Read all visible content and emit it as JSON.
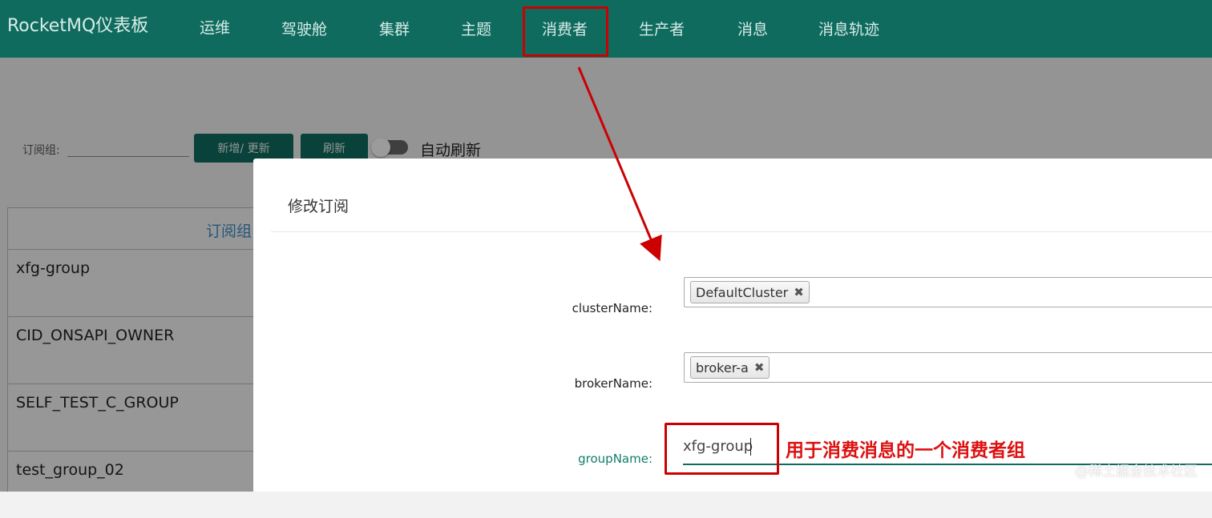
{
  "header": {
    "brand": "RocketMQ仪表板",
    "nav": [
      "运维",
      "驾驶舱",
      "集群",
      "主题",
      "消费者",
      "生产者",
      "消息",
      "消息轨迹"
    ],
    "active_nav": "消费者",
    "color": "#0f6b5e"
  },
  "toolbar": {
    "filter_label": "订阅组:",
    "add_update_label": "新增/ 更新",
    "refresh_label": "刷新",
    "auto_refresh_label": "自动刷新"
  },
  "table": {
    "header": "订阅组",
    "rows": [
      "xfg-group",
      "CID_ONSAPI_OWNER",
      "SELF_TEST_C_GROUP",
      "test_group_02"
    ]
  },
  "modal": {
    "title": "修改订阅",
    "cluster_label": "clusterName:",
    "cluster_tag": "DefaultCluster",
    "broker_label": "brokerName:",
    "broker_tag": "broker-a",
    "group_label": "groupName:",
    "group_value": "xfg-group",
    "remove_glyph": "✖"
  },
  "annotation": {
    "note": "用于消费消息的一个消费者组",
    "color": "#cc0000"
  },
  "watermark": "@稀土掘金技术社区"
}
